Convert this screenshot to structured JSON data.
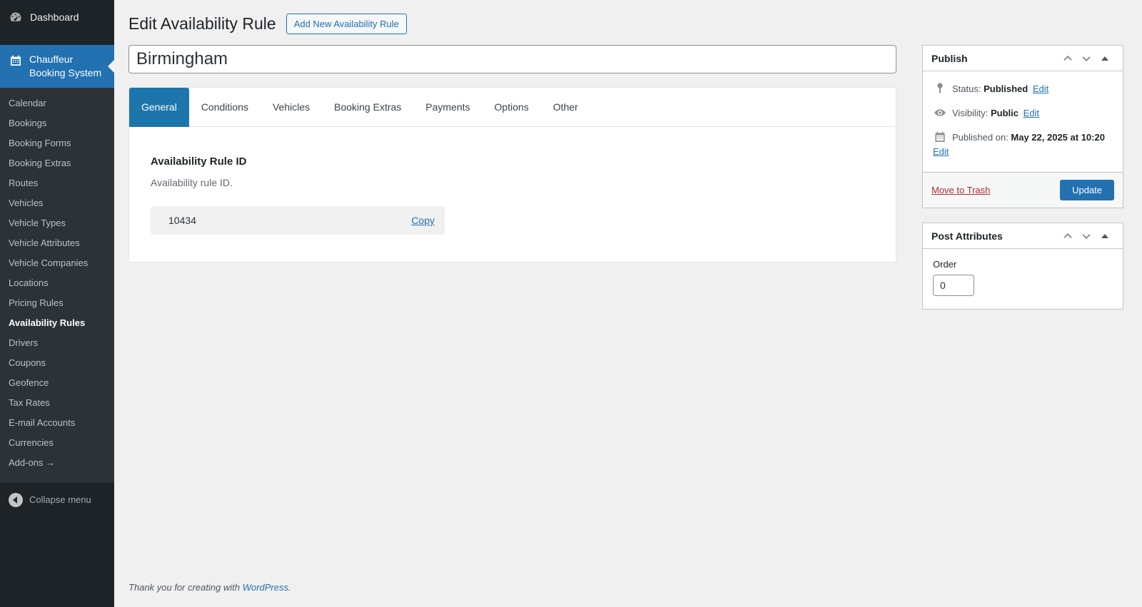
{
  "colors": {
    "accent": "#2271b1",
    "sidebar_bg": "#1d2327",
    "submenu_bg": "#2c3338",
    "active_tab_bg": "#1c76ab",
    "page_bg": "#f0f0f1",
    "trash_red": "#b32d2e"
  },
  "sidebar": {
    "dashboard_label": "Dashboard",
    "plugin_name": "Chauffeur Booking System",
    "items": [
      {
        "label": "Calendar"
      },
      {
        "label": "Bookings"
      },
      {
        "label": "Booking Forms"
      },
      {
        "label": "Booking Extras"
      },
      {
        "label": "Routes"
      },
      {
        "label": "Vehicles"
      },
      {
        "label": "Vehicle Types"
      },
      {
        "label": "Vehicle Attributes"
      },
      {
        "label": "Vehicle Companies"
      },
      {
        "label": "Locations"
      },
      {
        "label": "Pricing Rules"
      },
      {
        "label": "Availability Rules"
      },
      {
        "label": "Drivers"
      },
      {
        "label": "Coupons"
      },
      {
        "label": "Geofence"
      },
      {
        "label": "Tax Rates"
      },
      {
        "label": "E-mail Accounts"
      },
      {
        "label": "Currencies"
      },
      {
        "label": "Add-ons →"
      }
    ],
    "collapse_label": "Collapse menu"
  },
  "header": {
    "title": "Edit Availability Rule",
    "add_new_label": "Add New Availability Rule"
  },
  "title_field": {
    "value": "Birmingham"
  },
  "tabs": [
    {
      "label": "General"
    },
    {
      "label": "Conditions"
    },
    {
      "label": "Vehicles"
    },
    {
      "label": "Booking Extras"
    },
    {
      "label": "Payments"
    },
    {
      "label": "Options"
    },
    {
      "label": "Other"
    }
  ],
  "general_tab": {
    "heading": "Availability Rule ID",
    "description": "Availability rule ID.",
    "rule_id": "10434",
    "copy_label": "Copy"
  },
  "publish_box": {
    "title": "Publish",
    "status_label": "Status:",
    "status_value": "Published",
    "visibility_label": "Visibility:",
    "visibility_value": "Public",
    "published_label": "Published on:",
    "published_value": "May 22, 2025 at 10:20",
    "edit_label": "Edit",
    "trash_label": "Move to Trash",
    "update_label": "Update"
  },
  "attributes_box": {
    "title": "Post Attributes",
    "order_label": "Order",
    "order_value": "0"
  },
  "footer": {
    "thanks_prefix": "Thank you for creating with",
    "link_label": "WordPress",
    "suffix": "."
  }
}
